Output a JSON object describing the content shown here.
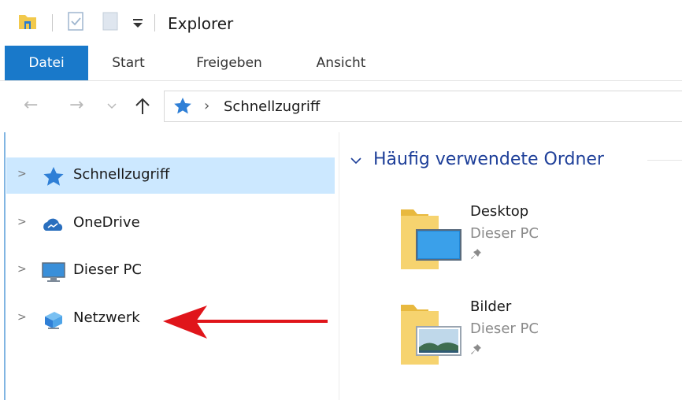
{
  "window": {
    "title": "Explorer"
  },
  "ribbon": {
    "tabs": [
      "Datei",
      "Start",
      "Freigeben",
      "Ansicht"
    ],
    "active_tab": "Datei",
    "active_color": "#1979ca"
  },
  "address_bar": {
    "location": "Schnellzugriff",
    "location_icon": "star-icon"
  },
  "nav_pane": {
    "items": [
      {
        "label": "Schnellzugriff",
        "icon": "quick-access-star-icon",
        "selected": true
      },
      {
        "label": "OneDrive",
        "icon": "onedrive-cloud-icon",
        "selected": false
      },
      {
        "label": "Dieser PC",
        "icon": "computer-monitor-icon",
        "selected": false
      },
      {
        "label": "Netzwerk",
        "icon": "network-icon",
        "selected": false
      }
    ],
    "selection_color": "#cce8ff"
  },
  "content": {
    "group_title": "Häufig verwendete Ordner",
    "folders": [
      {
        "name": "Desktop",
        "location": "Dieser PC",
        "icon": "desktop-folder-icon",
        "pinned": true
      },
      {
        "name": "Bilder",
        "location": "Dieser PC",
        "icon": "pictures-folder-icon",
        "pinned": true
      }
    ]
  },
  "annotation": {
    "arrow_color": "#e0151b",
    "points_to": "Netzwerk"
  }
}
